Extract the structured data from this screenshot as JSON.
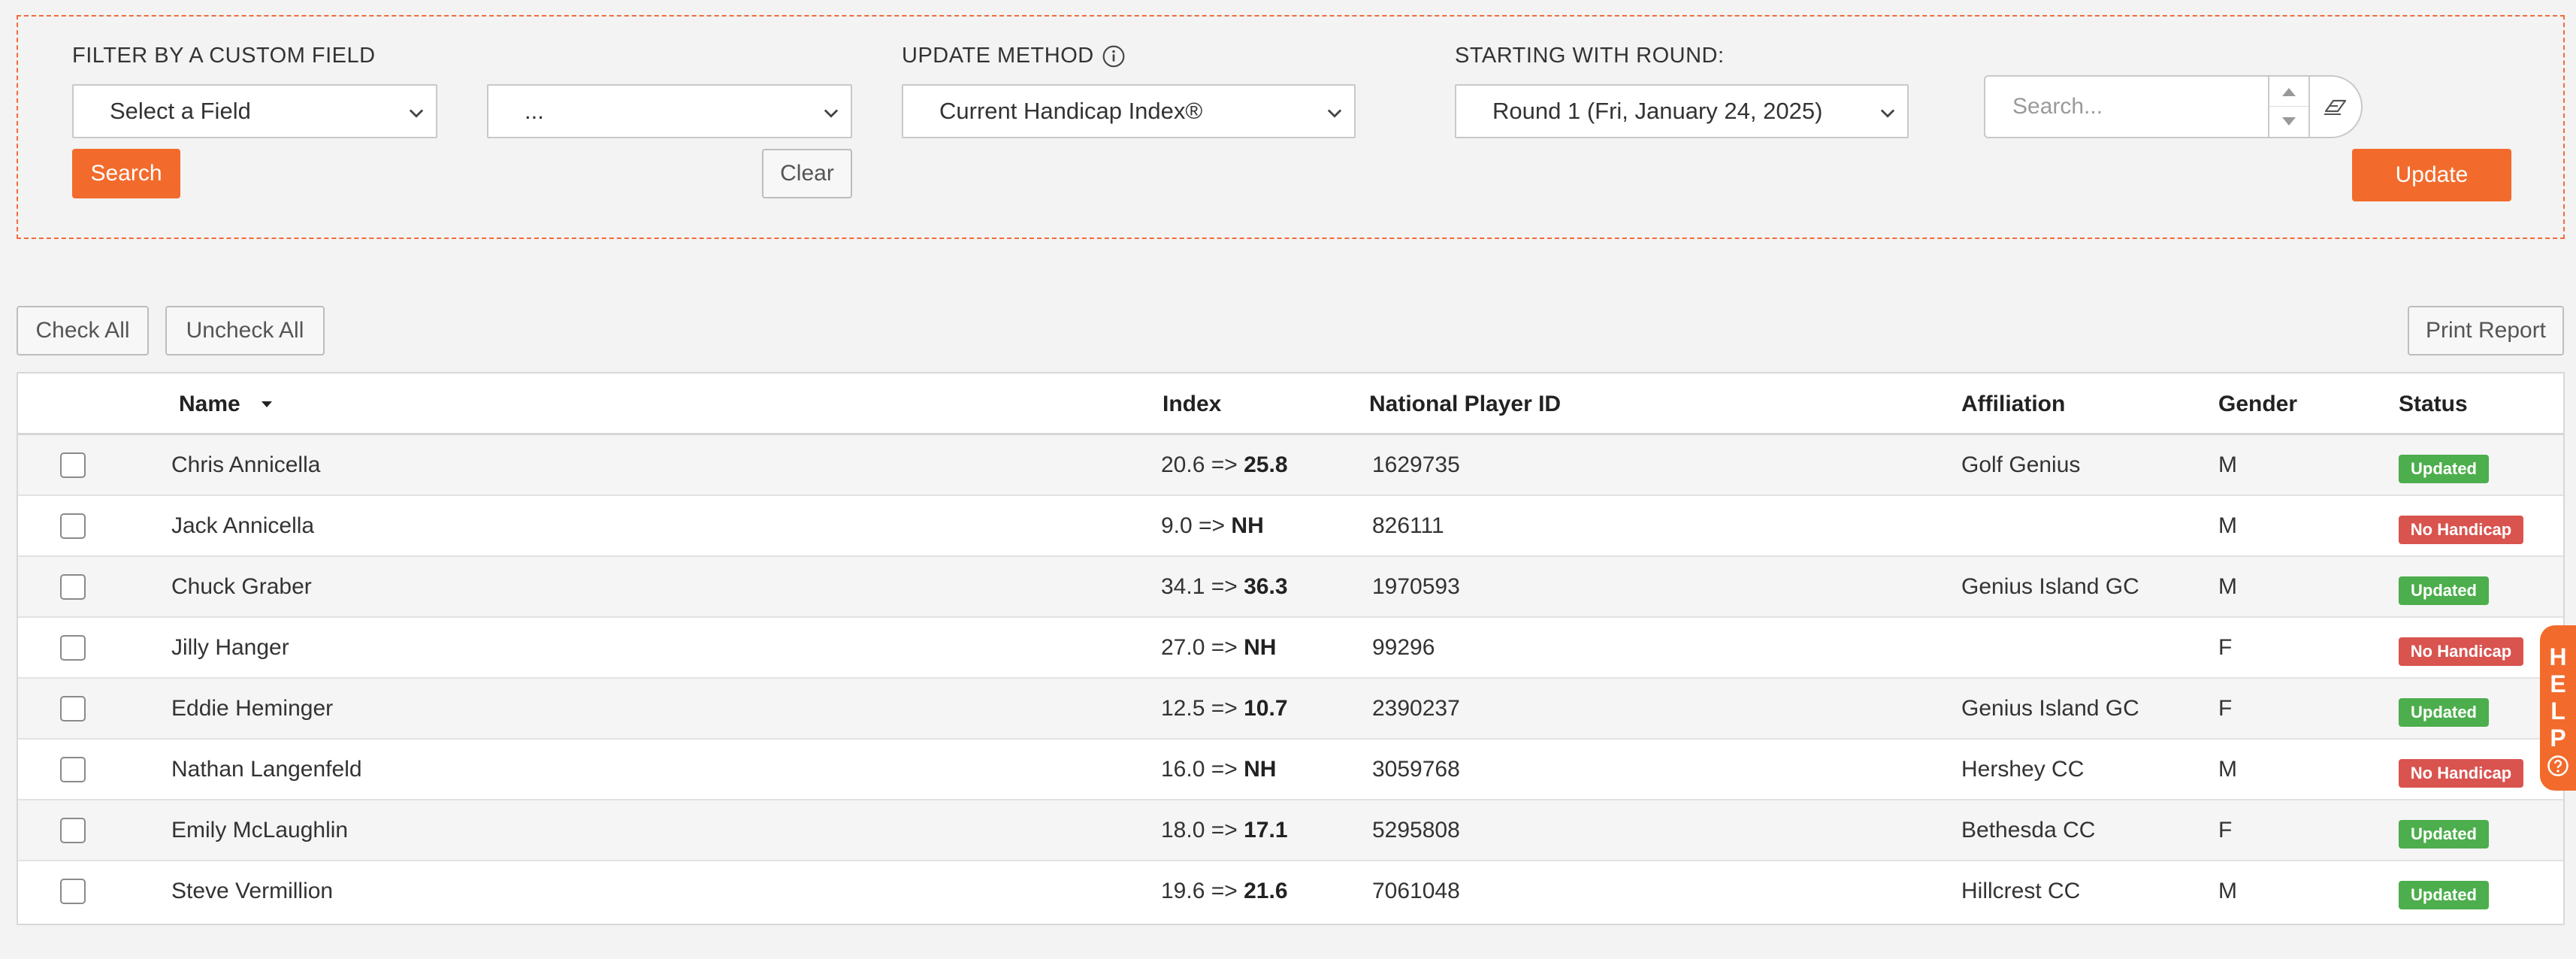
{
  "filter": {
    "custom_field_label": "FILTER BY A CUSTOM FIELD",
    "field_select_value": "Select a Field",
    "value_select_value": "...",
    "search_label": "Search",
    "clear_label": "Clear",
    "update_method_label": "UPDATE METHOD",
    "update_method_value": "Current Handicap Index®",
    "round_label": "STARTING WITH ROUND:",
    "round_value": "Round 1 (Fri, January 24, 2025)",
    "search_placeholder": "Search...",
    "update_label": "Update"
  },
  "toolbar": {
    "check_all": "Check All",
    "uncheck_all": "Uncheck All",
    "print_report": "Print Report"
  },
  "table": {
    "headers": {
      "name": "Name",
      "index": "Index",
      "npid": "National Player ID",
      "affiliation": "Affiliation",
      "gender": "Gender",
      "status": "Status"
    },
    "rows": [
      {
        "name": "Chris Annicella",
        "index_old": "20.6 =>",
        "index_new": "25.8",
        "npid": "1629735",
        "affiliation": "Golf Genius",
        "gender": "M",
        "status": "Updated"
      },
      {
        "name": "Jack Annicella",
        "index_old": "9.0 =>",
        "index_new": "NH",
        "npid": "826111",
        "affiliation": "",
        "gender": "M",
        "status": "No Handicap"
      },
      {
        "name": "Chuck Graber",
        "index_old": "34.1 =>",
        "index_new": "36.3",
        "npid": "1970593",
        "affiliation": "Genius Island GC",
        "gender": "M",
        "status": "Updated"
      },
      {
        "name": "Jilly Hanger",
        "index_old": "27.0 =>",
        "index_new": "NH",
        "npid": "99296",
        "affiliation": "",
        "gender": "F",
        "status": "No Handicap"
      },
      {
        "name": "Eddie Heminger",
        "index_old": "12.5 =>",
        "index_new": "10.7",
        "npid": "2390237",
        "affiliation": "Genius Island GC",
        "gender": "F",
        "status": "Updated"
      },
      {
        "name": "Nathan Langenfeld",
        "index_old": "16.0 =>",
        "index_new": "NH",
        "npid": "3059768",
        "affiliation": "Hershey CC",
        "gender": "M",
        "status": "No Handicap"
      },
      {
        "name": "Emily McLaughlin",
        "index_old": "18.0 =>",
        "index_new": "17.1",
        "npid": "5295808",
        "affiliation": "Bethesda CC",
        "gender": "F",
        "status": "Updated"
      },
      {
        "name": "Steve Vermillion",
        "index_old": "19.6 =>",
        "index_new": "21.6",
        "npid": "7061048",
        "affiliation": "Hillcrest CC",
        "gender": "M",
        "status": "Updated"
      }
    ]
  },
  "help": {
    "letters": [
      "H",
      "E",
      "L",
      "P"
    ]
  },
  "colors": {
    "accent": "#f26b2c",
    "updated": "#4cae4c",
    "no_handicap": "#d9534f"
  },
  "icons": {
    "info": "info-icon",
    "chevron": "chevron-down-icon",
    "sort": "sort-desc-icon",
    "eraser": "eraser-icon",
    "help": "question-circle-icon"
  }
}
